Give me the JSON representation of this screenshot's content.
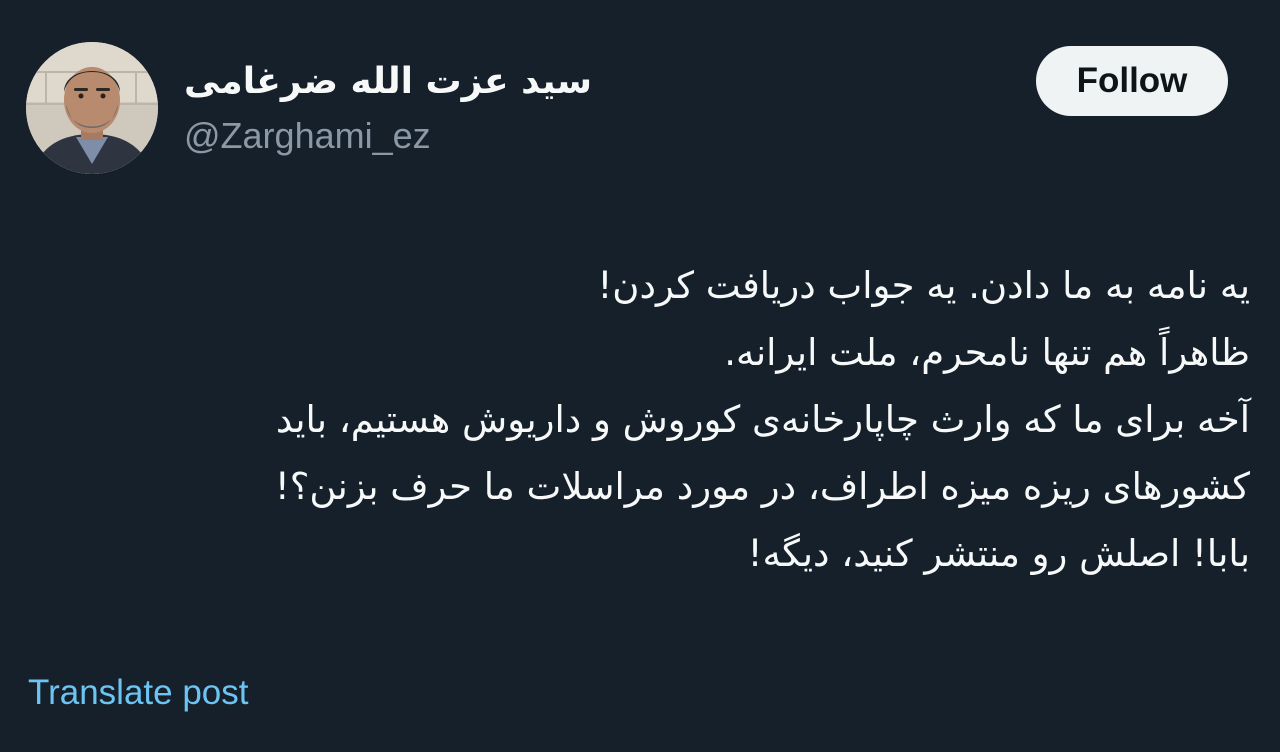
{
  "author": {
    "display_name": "سید عزت الله ضرغامی",
    "handle": "@Zarghami_ez"
  },
  "follow_button": {
    "label": "Follow"
  },
  "tweet": {
    "lines": [
      "یه نامه به ما دادن. یه جواب دریافت کردن!",
      "ظاهراً هم تنها نامحرم، ملت ایرانه.",
      "آخه برای ما که وارث چاپارخانه‌ی کوروش و داریوش هستیم، باید",
      "کشورهای ریزه میزه اطراف، در مورد مراسلات ما حرف بزنن؟!",
      "بابا! اصلش رو منتشر کنید، دیگه!"
    ]
  },
  "translate": {
    "label": "Translate post"
  },
  "colors": {
    "background": "#15202b",
    "text_primary": "#f7f9f9",
    "text_secondary": "#8b98a5",
    "link": "#6cc4f2",
    "button_bg": "#eff3f4"
  }
}
